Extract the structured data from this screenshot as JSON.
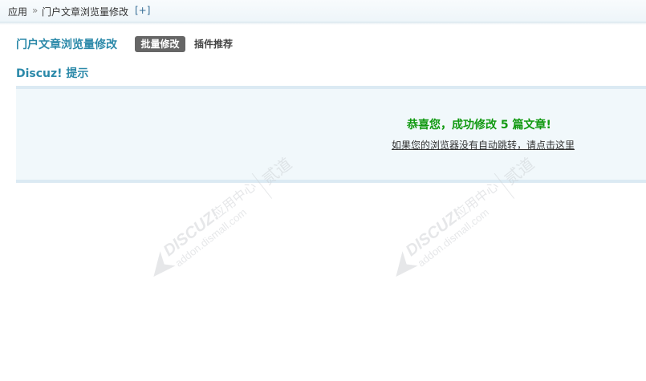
{
  "breadcrumb": {
    "root": "应用",
    "separator": "»",
    "current": "门户文章浏览量修改",
    "add_label": "[+]"
  },
  "header": {
    "title": "门户文章浏览量修改",
    "tabs": [
      {
        "label": "批量修改",
        "active": true
      },
      {
        "label": "插件推荐",
        "active": false
      }
    ]
  },
  "section": {
    "title": "Discuz! 提示"
  },
  "message": {
    "success": "恭喜您，成功修改 5 篇文章!",
    "redirect_link": "如果您的浏览器没有自动跳转，请点击这里"
  },
  "watermark": {
    "brand": "DISCUZ!",
    "app_center": "应用中心",
    "url": "addon.dismall.com",
    "author": "贰道"
  },
  "colors": {
    "accent": "#2b89a9",
    "success": "#109910",
    "tab_active_bg": "#666666",
    "box_bg": "#f1f8fb",
    "box_border": "#dbeaf3",
    "watermark": "#c9ccd0"
  }
}
